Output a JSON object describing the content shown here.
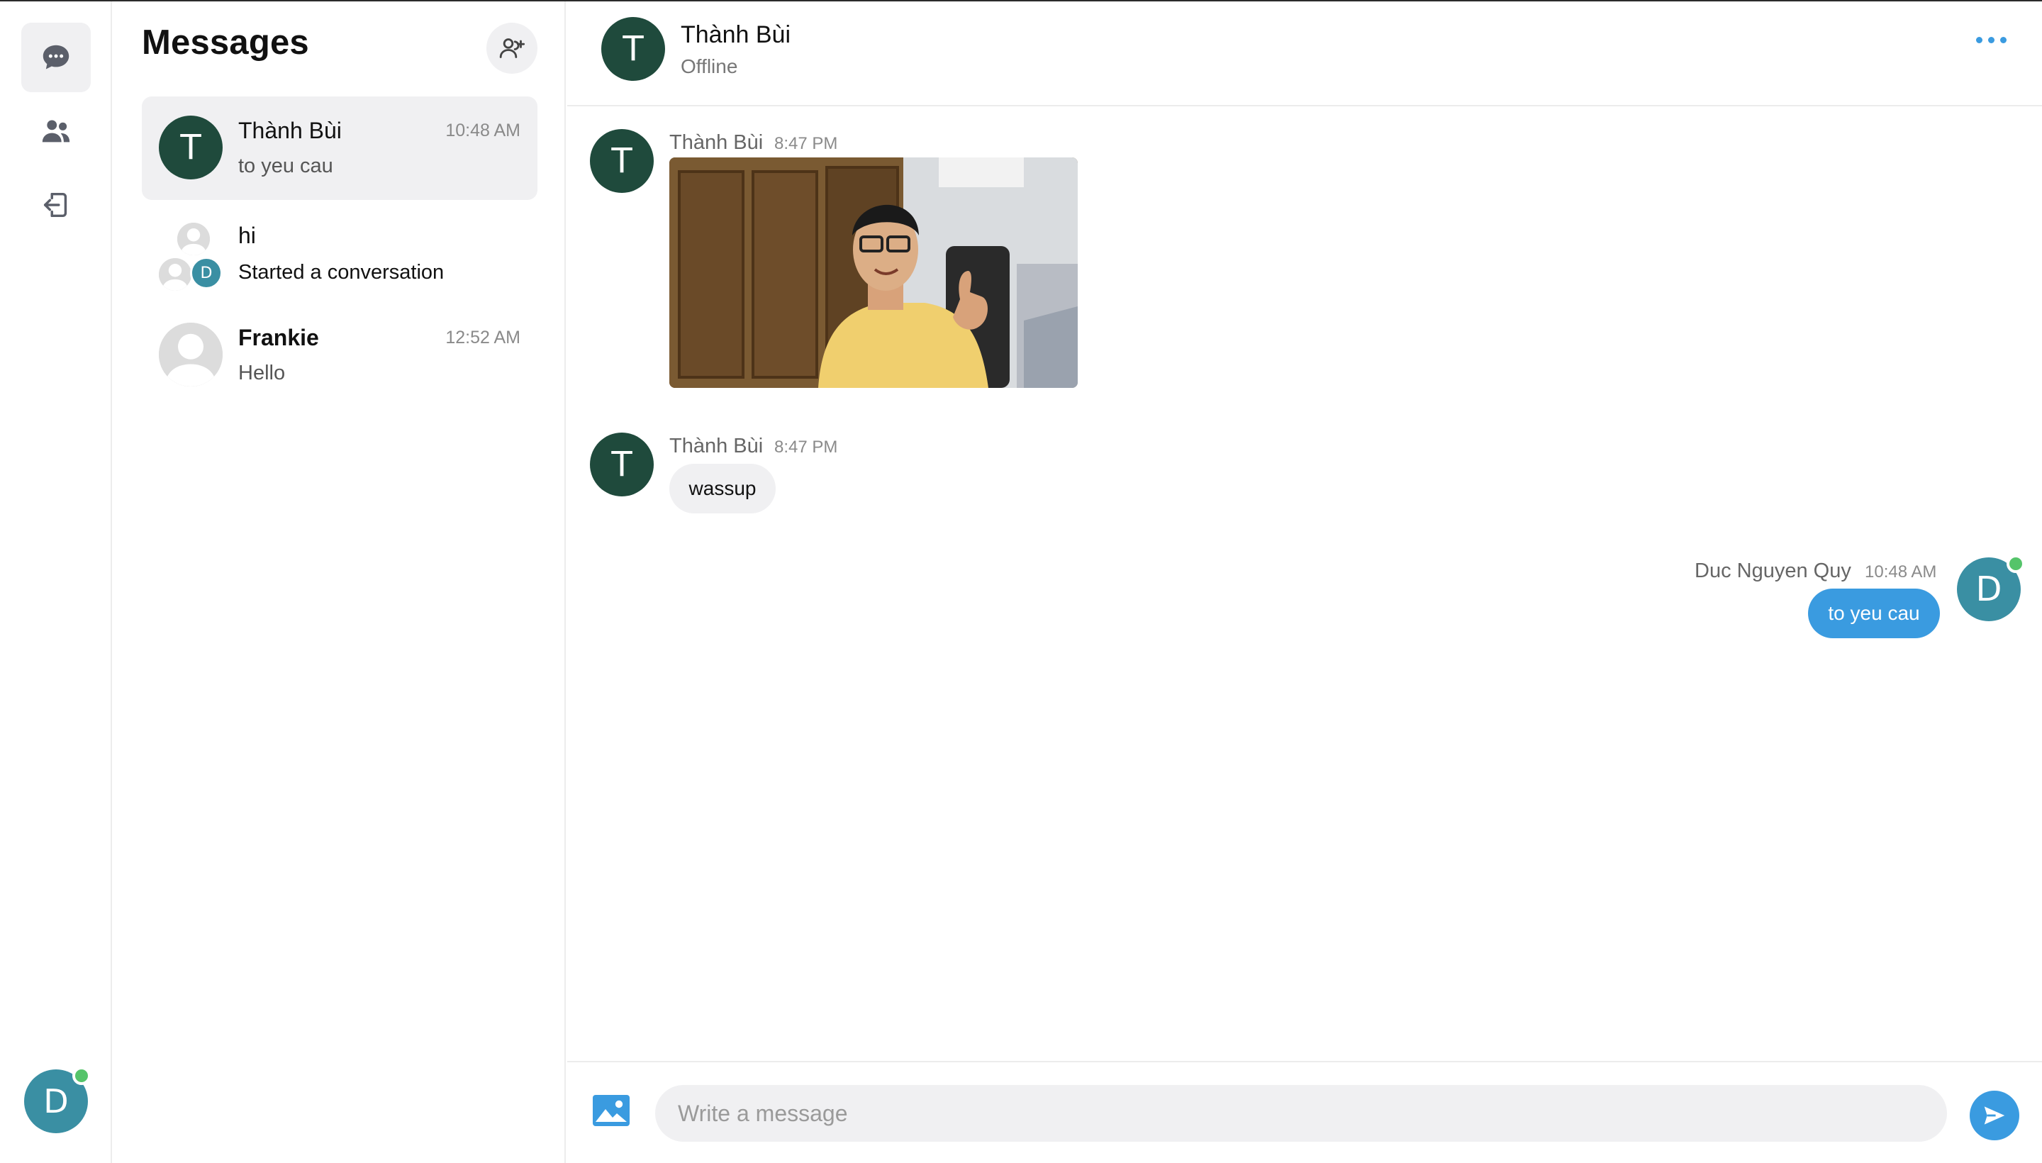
{
  "colors": {
    "accent": "#3a9be0",
    "online": "#55c46a",
    "avatar_t": "#1f4a3c",
    "avatar_d": "#3a8fa3"
  },
  "rail": {
    "items": [
      {
        "icon": "chat-bubble-icon",
        "active": true
      },
      {
        "icon": "users-icon",
        "active": false
      },
      {
        "icon": "logout-icon",
        "active": false
      }
    ],
    "user_initial": "D"
  },
  "sidebar": {
    "title": "Messages",
    "add_icon": "user-plus-icon",
    "conversations": [
      {
        "initial": "T",
        "name": "Thành Bùi",
        "preview": "to yeu cau",
        "time": "10:48 AM"
      },
      {
        "group_initial": "D",
        "name": "hi",
        "preview": "Started a conversation",
        "time": ""
      },
      {
        "name": "Frankie",
        "preview": "Hello",
        "time": "12:52 AM"
      }
    ]
  },
  "chat": {
    "header": {
      "initial": "T",
      "name": "Thành Bùi",
      "status": "Offline",
      "more_icon": "more-horizontal-icon"
    },
    "messages": [
      {
        "sender": "Thành Bùi",
        "initial": "T",
        "time": "8:47 PM",
        "type": "image"
      },
      {
        "sender": "Thành Bùi",
        "initial": "T",
        "time": "8:47 PM",
        "type": "text",
        "text": "wassup"
      },
      {
        "sender": "Duc Nguyen Quy",
        "initial": "D",
        "time": "10:48 AM",
        "type": "text",
        "text": "to yeu cau",
        "outgoing": true
      }
    ],
    "composer": {
      "placeholder": "Write a message",
      "image_icon": "image-icon",
      "send_icon": "send-icon"
    }
  }
}
